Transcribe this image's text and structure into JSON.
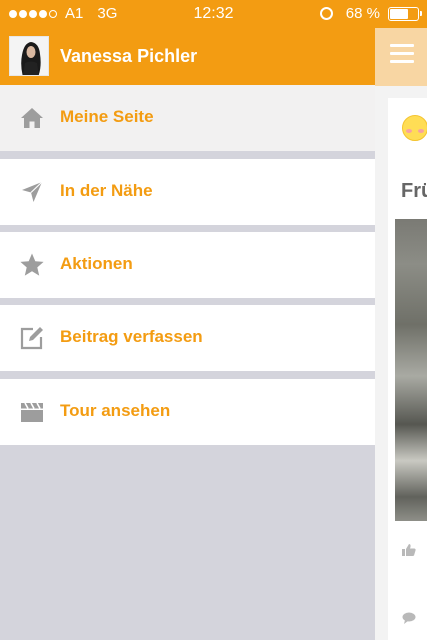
{
  "status_bar": {
    "carrier": "A1",
    "network": "3G",
    "time": "12:32",
    "battery": "68 %",
    "battery_level": 0.68,
    "signal_bars_filled": 4,
    "signal_bars_total": 5
  },
  "drawer": {
    "user_name": "Vanessa Pichler",
    "items": [
      {
        "label": "Meine Seite",
        "icon": "home-icon",
        "active": true
      },
      {
        "label": "In der Nähe",
        "icon": "location-arrow-icon",
        "active": false
      },
      {
        "label": "Aktionen",
        "icon": "star-icon",
        "active": false
      },
      {
        "label": "Beitrag verfassen",
        "icon": "compose-icon",
        "active": false
      },
      {
        "label": "Tour ansehen",
        "icon": "clapperboard-icon",
        "active": false
      }
    ]
  },
  "content": {
    "card_title": "Frü"
  },
  "colors": {
    "accent": "#f39c12",
    "icon_gray": "#9d9d9d",
    "drawer_bg": "#d4d4dc"
  }
}
